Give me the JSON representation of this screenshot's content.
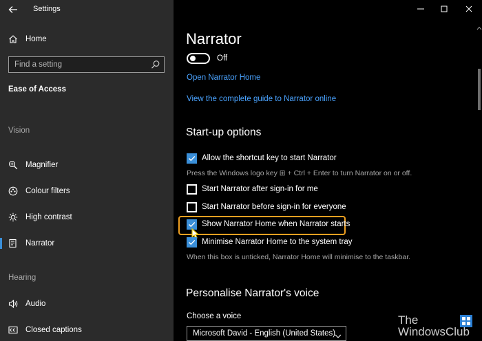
{
  "window": {
    "title": "Settings"
  },
  "sidebar": {
    "home_label": "Home",
    "search_placeholder": "Find a setting",
    "section_title": "Ease of Access",
    "groups": {
      "vision": "Vision",
      "hearing": "Hearing"
    },
    "items": [
      {
        "label": "Magnifier",
        "icon": "magnifier-icon"
      },
      {
        "label": "Colour filters",
        "icon": "colour-filters-icon"
      },
      {
        "label": "High contrast",
        "icon": "high-contrast-icon"
      },
      {
        "label": "Narrator",
        "icon": "narrator-icon",
        "selected": true
      },
      {
        "label": "Audio",
        "icon": "audio-icon"
      },
      {
        "label": "Closed captions",
        "icon": "closed-captions-icon"
      }
    ]
  },
  "main": {
    "title": "Narrator",
    "toggle": {
      "state": "Off",
      "on": false
    },
    "links": {
      "open_home": "Open Narrator Home",
      "guide": "View the complete guide to Narrator online"
    },
    "startup": {
      "heading": "Start-up options",
      "options": [
        {
          "label": "Allow the shortcut key to start Narrator",
          "checked": true
        },
        {
          "label": "Start Narrator after sign-in for me",
          "checked": false
        },
        {
          "label": "Start Narrator before sign-in for everyone",
          "checked": false
        },
        {
          "label": "Show Narrator Home when Narrator starts",
          "checked": true
        },
        {
          "label": "Minimise Narrator Home to the system tray",
          "checked": true
        }
      ],
      "shortcut_note": "Press the Windows logo key ⊞ + Ctrl + Enter to turn Narrator on or off.",
      "tray_note": "When this box is unticked, Narrator Home will minimise to the taskbar."
    },
    "voice": {
      "heading": "Personalise Narrator's voice",
      "choose_label": "Choose a voice",
      "selected_voice": "Microsoft David - English (United States)"
    }
  },
  "watermark": {
    "line1": "The",
    "line2": "WindowsClub"
  },
  "colors": {
    "accent": "#3a8fd9",
    "link": "#4aa3ff",
    "highlight": "#f0a020",
    "sidebar_bg": "#2b2b2b",
    "main_bg": "#000000"
  }
}
